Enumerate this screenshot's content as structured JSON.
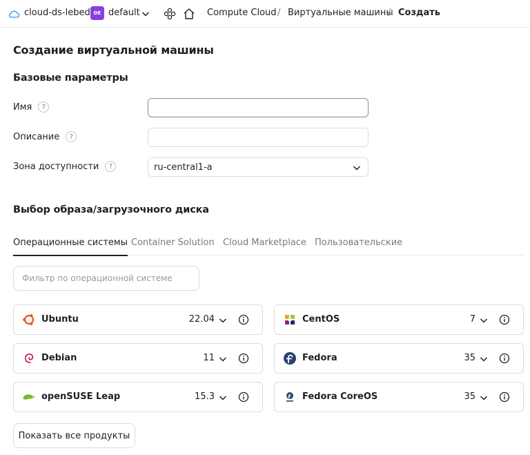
{
  "header": {
    "cloud_name": "cloud-ds-lebed",
    "folder_badge": "DE",
    "folder_name": "default",
    "breadcrumbs": [
      "Compute Cloud",
      "Виртуальные машины",
      "Создать"
    ],
    "separator": "/"
  },
  "page_title": "Создание виртуальной машины",
  "basic": {
    "title": "Базовые параметры",
    "name_label": "Имя",
    "name_value": "",
    "description_label": "Описание",
    "description_value": "",
    "zone_label": "Зона доступности",
    "zone_value": "ru-central1-a",
    "help": "?"
  },
  "image": {
    "title": "Выбор образа/загрузочного диска",
    "tabs": [
      "Операционные системы",
      "Container Solution",
      "Cloud Marketplace",
      "Пользовательские"
    ],
    "filter_placeholder": "Фильтр по операционной системе",
    "os": [
      {
        "name": "Ubuntu",
        "version": "22.04",
        "icon": "ubuntu-logo-icon"
      },
      {
        "name": "CentOS",
        "version": "7",
        "icon": "centos-logo-icon"
      },
      {
        "name": "Debian",
        "version": "11",
        "icon": "debian-logo-icon"
      },
      {
        "name": "Fedora",
        "version": "35",
        "icon": "fedora-logo-icon"
      },
      {
        "name": "openSUSE Leap",
        "version": "15.3",
        "icon": "opensuse-logo-icon"
      },
      {
        "name": "Fedora CoreOS",
        "version": "35",
        "icon": "fedora-coreos-logo-icon"
      }
    ],
    "show_all_label": "Показать все продукты"
  },
  "colors": {
    "folder_badge": "#8b3ee0",
    "ubuntu": "#e95420",
    "fedora": "#294172",
    "opensuse": "#73ba25",
    "debian": "#c70036"
  }
}
